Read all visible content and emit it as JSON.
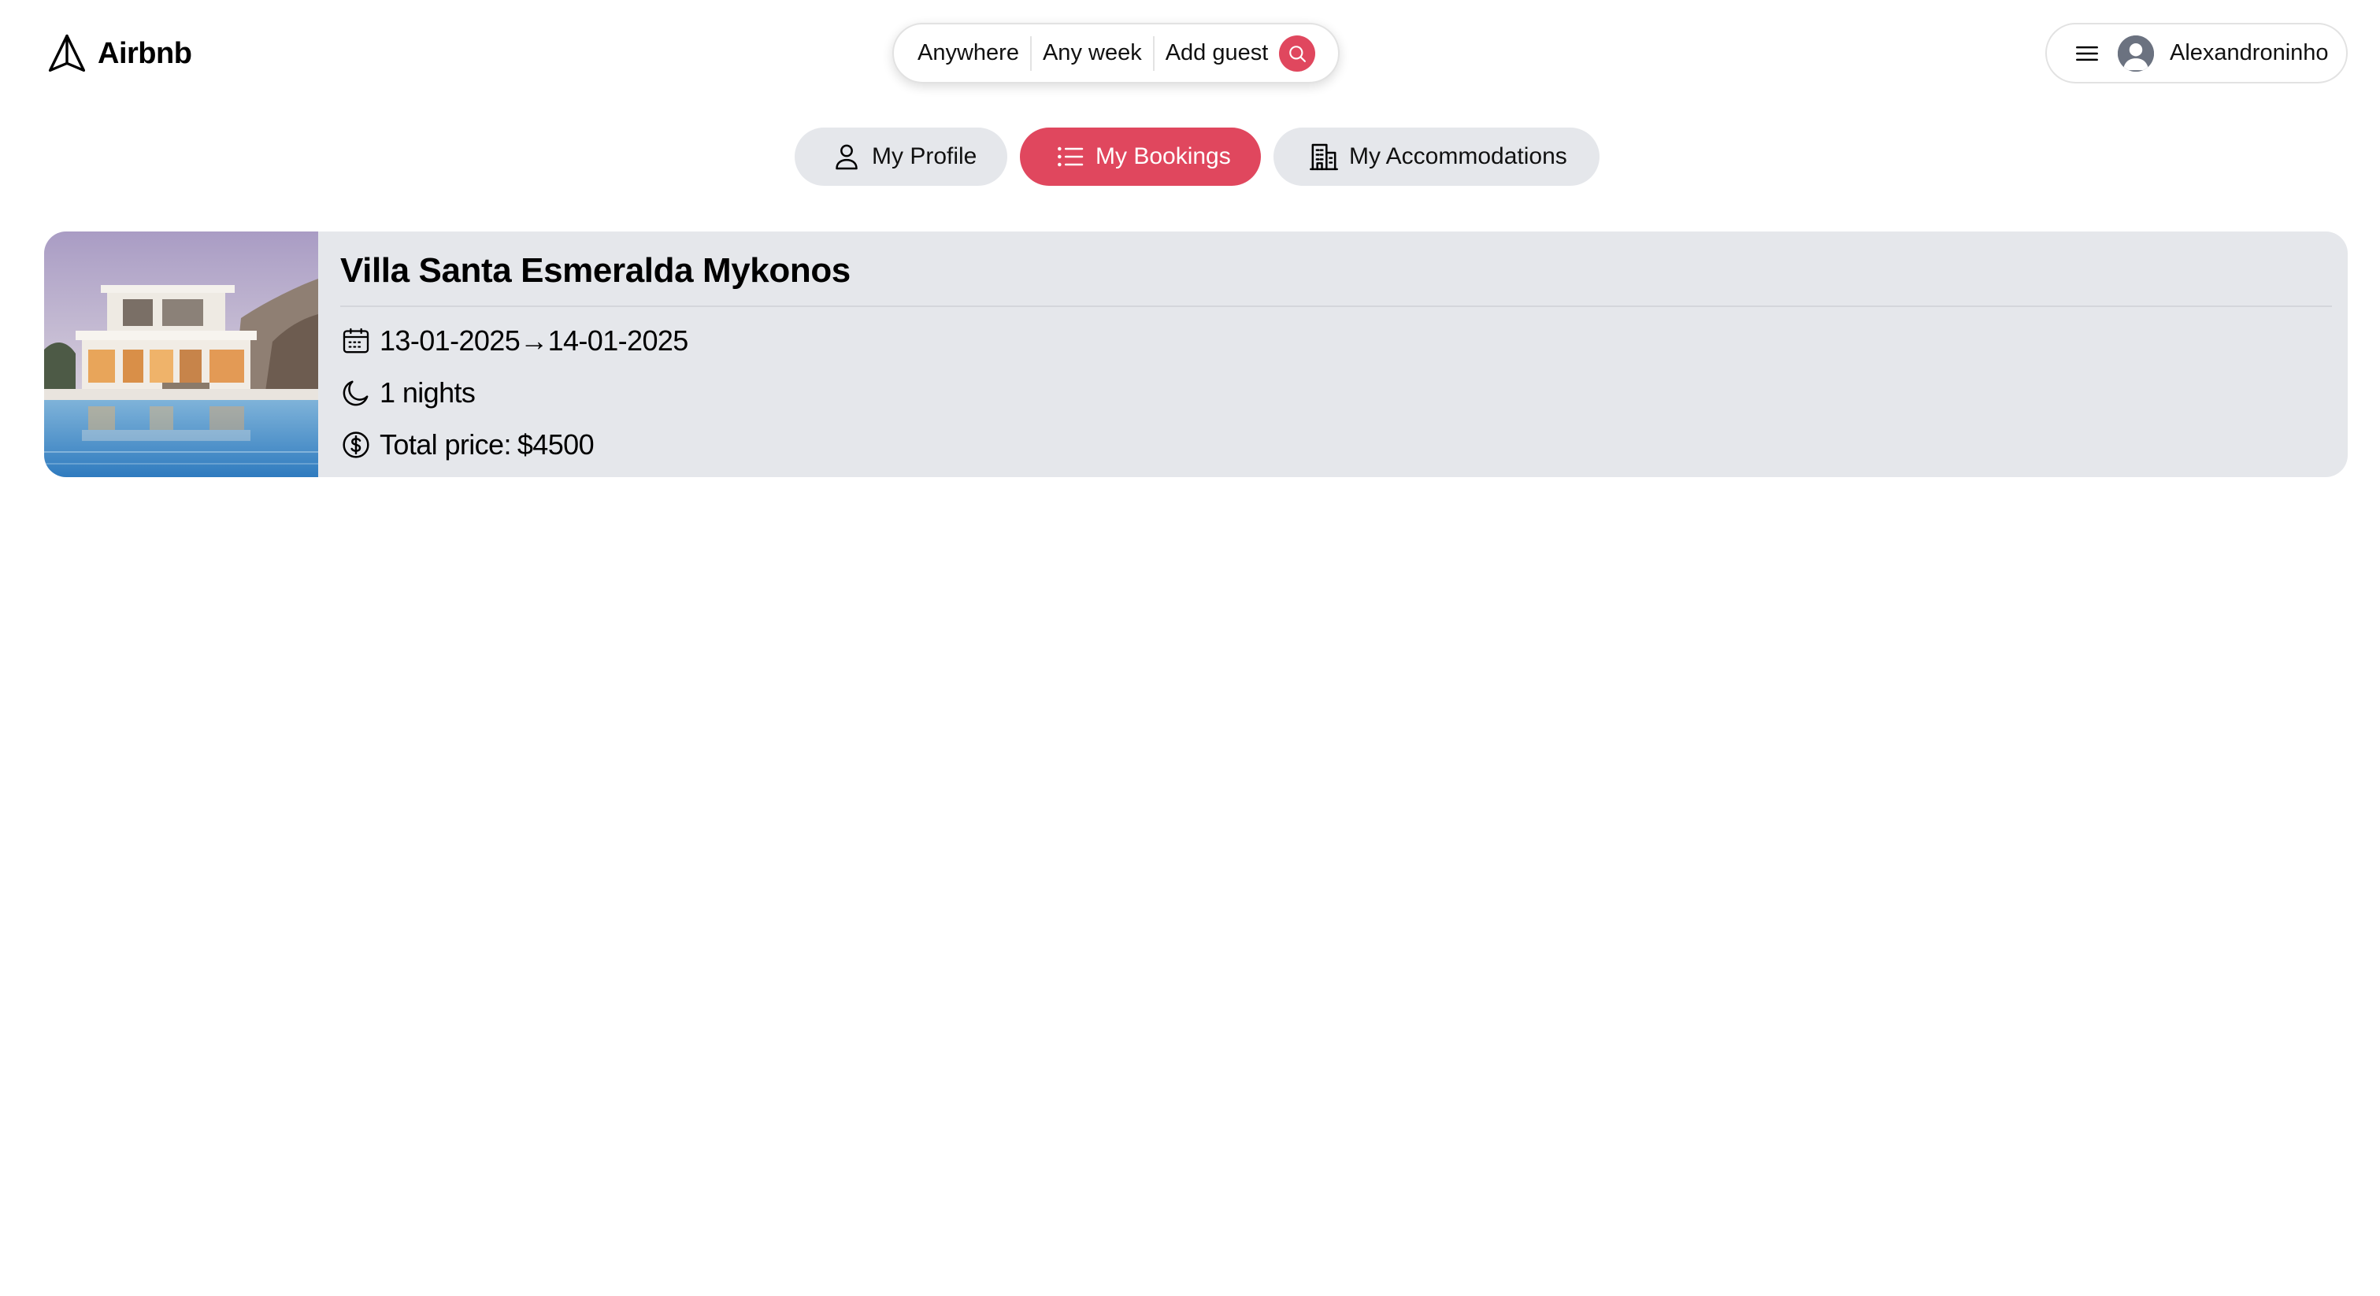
{
  "header": {
    "logo_text": "Airbnb",
    "search": {
      "location": "Anywhere",
      "week": "Any week",
      "guests": "Add guest"
    },
    "user_name": "Alexandroninho"
  },
  "tabs": [
    {
      "label": "My Profile",
      "icon": "user-icon",
      "active": false
    },
    {
      "label": "My Bookings",
      "icon": "list-icon",
      "active": true
    },
    {
      "label": "My Accommodations",
      "icon": "building-icon",
      "active": false
    }
  ],
  "bookings": [
    {
      "title": "Villa Santa Esmeralda Mykonos",
      "check_in": "13-01-2025",
      "check_out": "14-01-2025",
      "arrow": "→",
      "nights": "1 nights",
      "total_price_label": "Total price:",
      "total_price": "$4500"
    }
  ],
  "colors": {
    "accent": "#e0475e",
    "tab_bg": "#e5e7eb",
    "card_bg": "#e5e7eb"
  }
}
